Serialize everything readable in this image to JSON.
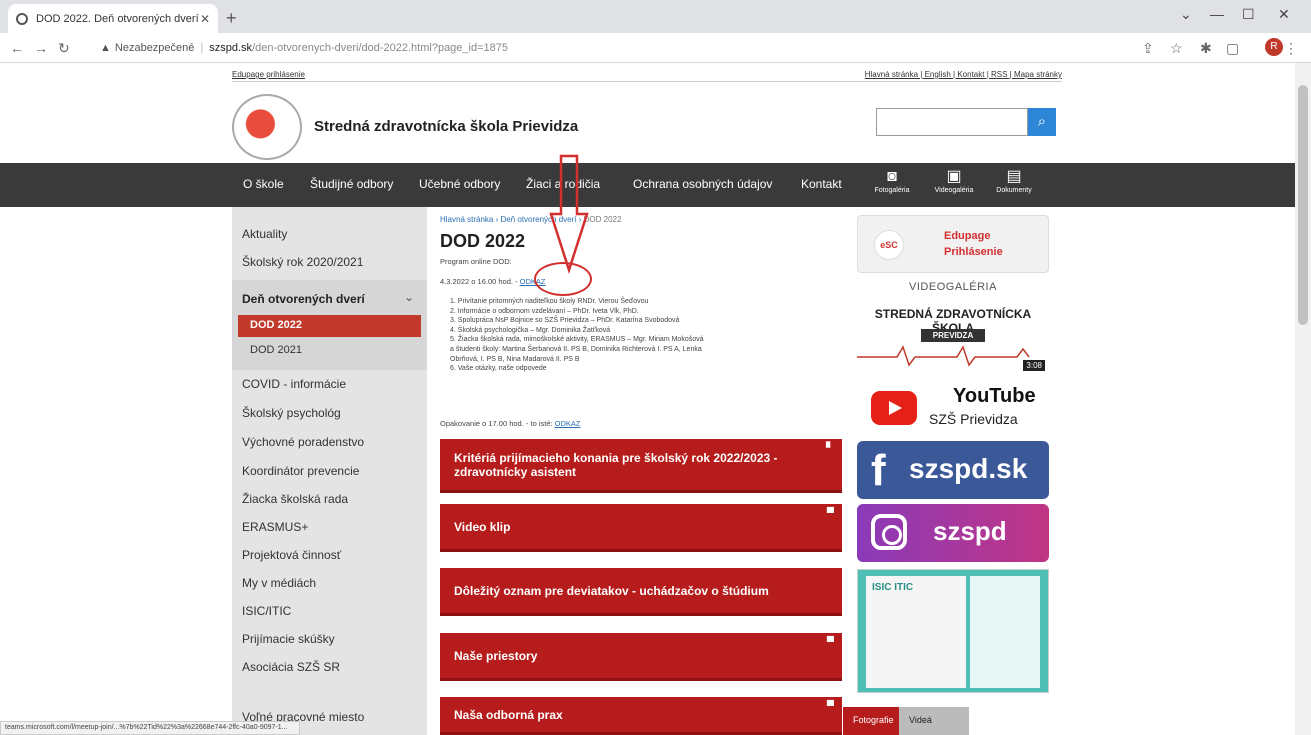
{
  "browser": {
    "tab_title": "DOD 2022. Deň otvorených dverí",
    "address_warning": "Nezabezpečené",
    "address_host": "szspd.sk",
    "address_path": "/den-otvorenych-dveri/dod-2022.html?page_id=1875",
    "avatar_letter": "R",
    "status_url": "teams.microsoft.com/l/meetup-join/...%7b%22Tid%22%3a%22668e744-2ffc-40a0-9097-1..."
  },
  "topline": {
    "left_link": "Edupage prihlásenie",
    "right_links": "Hlavná stránka | English | Kontakt | RSS | Mapa stránky"
  },
  "header": {
    "site_name": "Stredná zdravotnícka škola Prievidza",
    "search_placeholder": ""
  },
  "mainnav": {
    "items": [
      "O škole",
      "Študijné odbory",
      "Učebné odbory",
      "Žiaci a rodičia",
      "Ochrana osobných údajov",
      "Kontakt"
    ],
    "icons": [
      "Fotogaléria",
      "Videogaléria",
      "Dokumenty"
    ]
  },
  "sidebar": {
    "items_top": [
      "Aktuality",
      "Školský rok 2020/2021"
    ],
    "group_title": "Deň otvorených dverí",
    "group_active": "DOD 2022",
    "group_sub": "DOD 2021",
    "items_bottom": [
      "COVID - informácie",
      "Školský psychológ",
      "Výchovné poradenstvo",
      "Koordinátor prevencie",
      "Žiacka školská rada",
      "ERASMUS+",
      "Projektová činnosť",
      "My v médiách",
      "ISIC/ITIC",
      "Prijímacie skúšky",
      "Asociácia SZŠ SR",
      "Voľné pracovné miesto"
    ]
  },
  "content": {
    "breadcrumb_link": "Hlavná stránka › Deň otvorených dverí ›",
    "breadcrumb_current": "DOD 2022",
    "title": "DOD 2022",
    "intro": "Program online DOD:",
    "date_line": "4.3.2022 o 16.00 hod. -",
    "date_link": "ODKAZ",
    "program": [
      "1. Privítanie pritomných riaditeľkou školy RNDr. Vierou Šeďovou",
      "2. Informácie o odbornom vzdelávaní – PhDr. Iveta Vlk, PhD.",
      "3. Spolupráca NsP Bojnice so SZŠ Prievidza – PhDr. Katarína Svobodová",
      "4. Školská psychologička – Mgr. Dominika Žatťková",
      "5. Žiacka školská rada, mimoškolské aktivity, ERASMUS – Mgr. Miriam Mokošová",
      "   a študenti školy: Martina Šerbanová II. PS B, Dominika Richterová I. PS A, Lenka",
      "   Obrňová, I. PS B, Nina Madarová II. PS B",
      "6. Vaše otázky, naše odpovede"
    ],
    "repeat_line": "Opakovanie o 17.00 hod. - to isté:",
    "repeat_link": "ODKAZ",
    "cards": [
      "Kritériá prijímacieho konania pre školský rok 2022/2023 - zdravotnícky asistent",
      "Video klip",
      "Dôležitý oznam pre deviatakov - uchádzačov o štúdium",
      "Naše priestory",
      "Naša odborná prax"
    ]
  },
  "right": {
    "edupage_logo": "eSC",
    "edupage_line1": "Edupage",
    "edupage_line2": "Prihlásenie",
    "videogaleria": "VIDEOGALÉRIA",
    "video_title": "STREDNÁ ZDRAVOTNÍCKA ŠKOLA",
    "video_sub": "PREVIDZA",
    "video_duration": "3:08",
    "youtube_word": "YouTube",
    "youtube_channel": "SZŠ Prievidza",
    "facebook": "szspd.sk",
    "instagram": "szspd",
    "isic_logo": "ISIC ITIC",
    "tab_photos": "Fotografie",
    "tab_video": "Videá"
  },
  "colors": {
    "accent_red": "#b71c1c",
    "nav_dark": "#3a3a3a",
    "facebook": "#3b5998",
    "link": "#2a6fb3"
  }
}
